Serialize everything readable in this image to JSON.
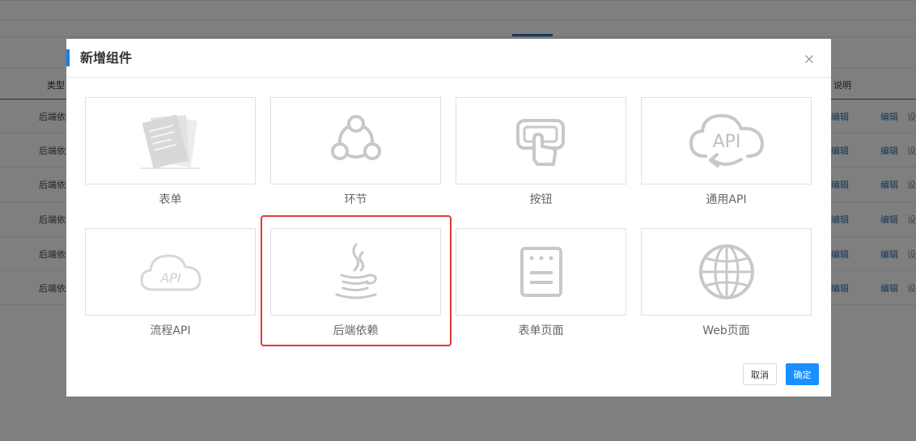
{
  "background": {
    "header_left": "类型",
    "header_right": "说明",
    "rows": [
      {
        "left": "后端依赖",
        "edit1": "编辑",
        "edit2": "编辑",
        "extra": "设"
      },
      {
        "left": "后端依赖",
        "edit1": "编辑",
        "edit2": "编辑",
        "extra": "设"
      },
      {
        "left": "后端依赖",
        "edit1": "编辑",
        "edit2": "编辑",
        "extra": "设"
      },
      {
        "left": "后端依赖",
        "edit1": "编辑",
        "edit2": "编辑",
        "extra": "设"
      },
      {
        "left": "后端依赖",
        "edit1": "编辑",
        "edit2": "编辑",
        "extra": "设"
      },
      {
        "left": "后端依赖",
        "edit1": "编辑",
        "edit2": "编辑",
        "extra": "设"
      }
    ]
  },
  "modal": {
    "title": "新增组件",
    "close_icon": "close-icon",
    "cards": [
      {
        "label": "表单",
        "icon": "form-icon"
      },
      {
        "label": "环节",
        "icon": "node-cycle-icon"
      },
      {
        "label": "按钮",
        "icon": "touch-button-icon"
      },
      {
        "label": "通用API",
        "icon": "cloud-api-icon",
        "icon_text": "API"
      },
      {
        "label": "流程API",
        "icon": "cloud-api-outline-icon",
        "icon_text": "API"
      },
      {
        "label": "后端依赖",
        "icon": "java-icon",
        "selected": true
      },
      {
        "label": "表单页面",
        "icon": "form-page-icon"
      },
      {
        "label": "Web页面",
        "icon": "globe-icon"
      }
    ],
    "cancel_label": "取消",
    "ok_label": "确定",
    "colors": {
      "accent": "#1e7be6",
      "primary_button": "#1890ff",
      "highlight": "#e53935",
      "icon_gray": "#c8c8c8"
    }
  }
}
